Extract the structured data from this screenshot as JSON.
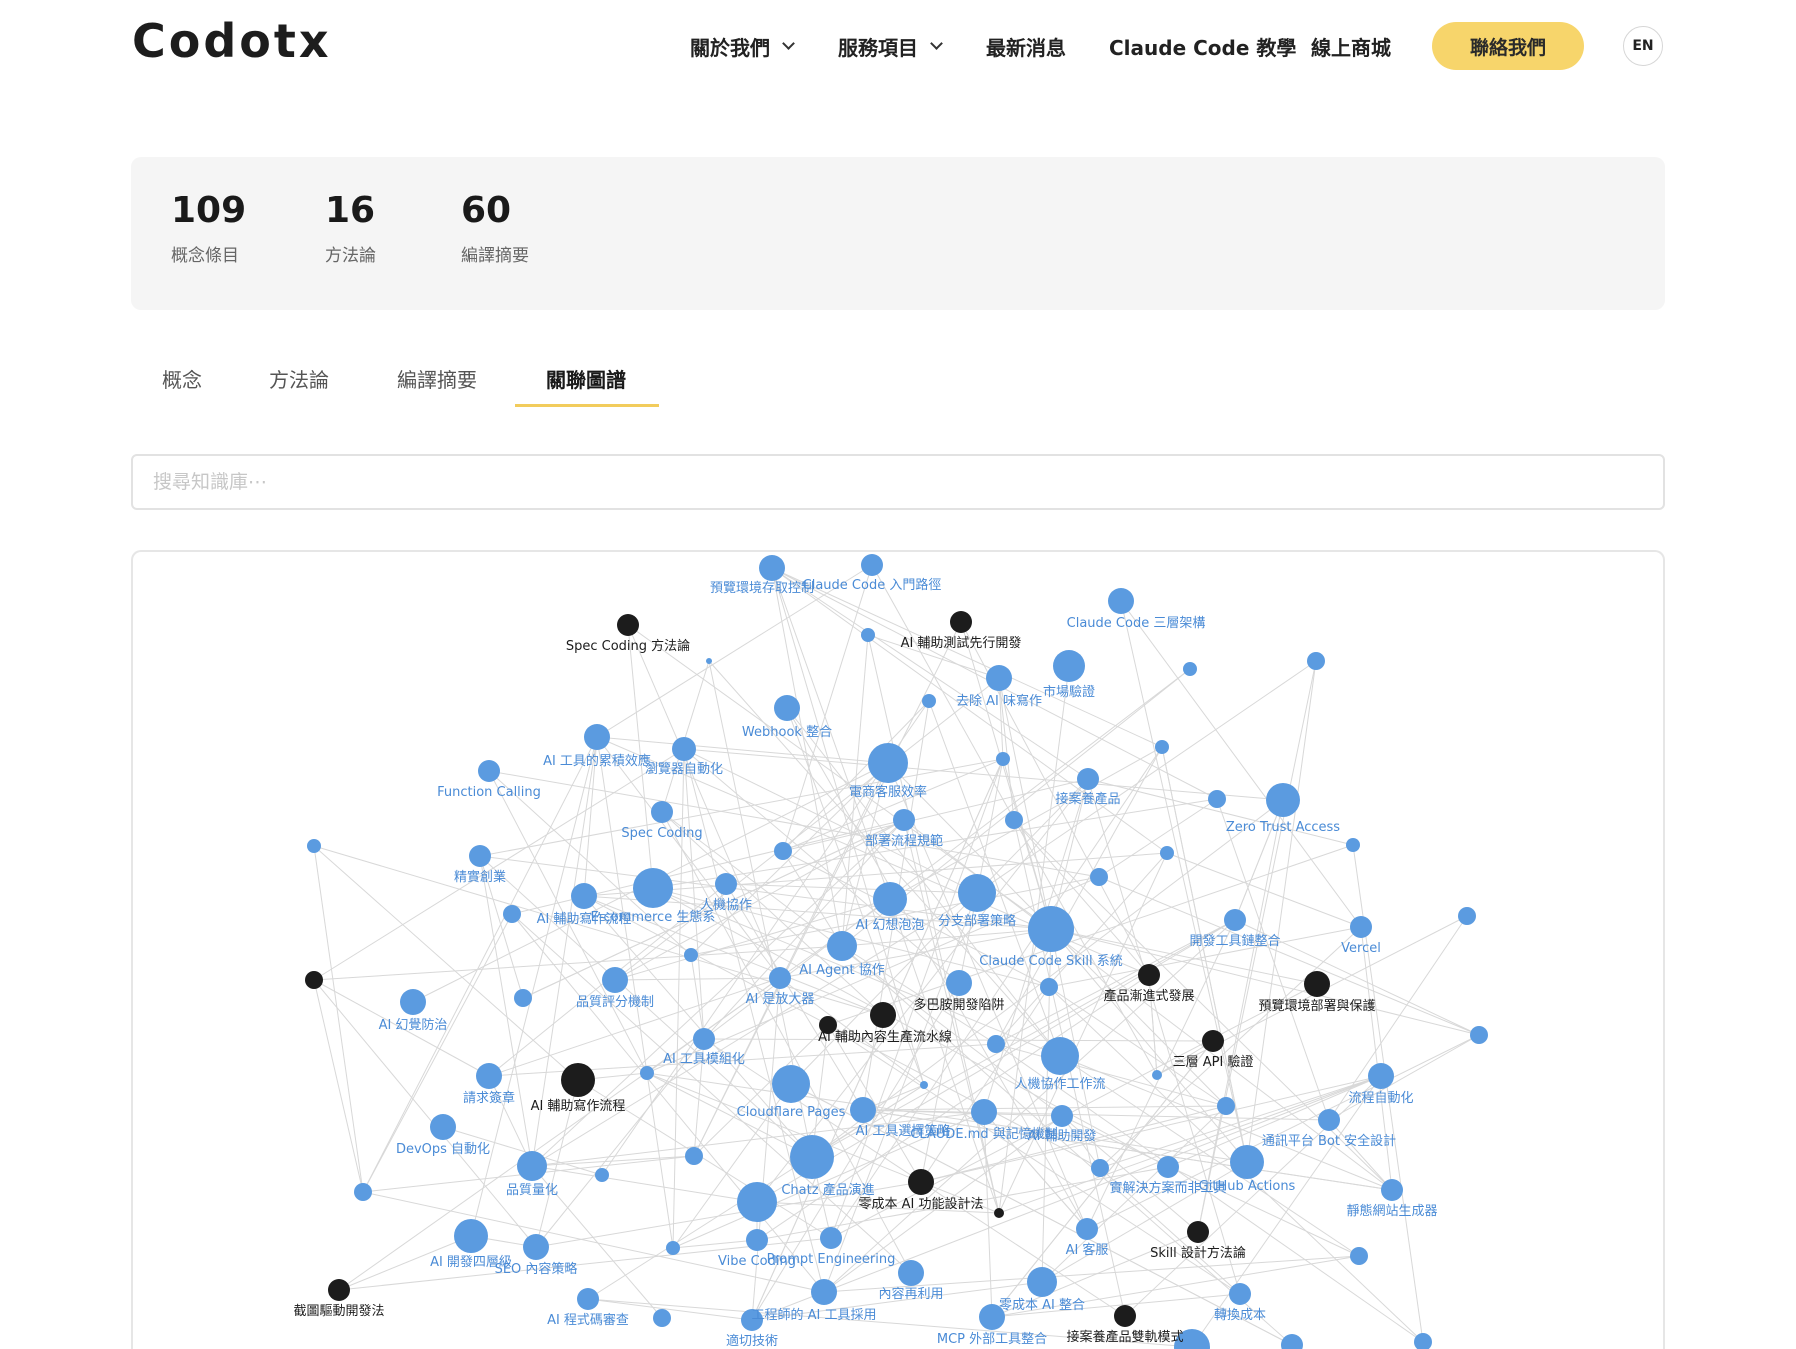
{
  "header": {
    "logo": "Codotx",
    "nav": [
      {
        "label": "關於我們",
        "dropdown": true
      },
      {
        "label": "服務項目",
        "dropdown": true
      },
      {
        "label": "最新消息",
        "dropdown": false
      },
      {
        "label": "Claude Code 教學",
        "dropdown": false
      },
      {
        "label": "線上商城",
        "dropdown": false
      }
    ],
    "cta_label": "聯絡我們",
    "lang_label": "EN"
  },
  "stats": [
    {
      "value": "109",
      "label": "概念條目"
    },
    {
      "value": "16",
      "label": "方法論"
    },
    {
      "value": "60",
      "label": "編譯摘要"
    }
  ],
  "tabs": [
    {
      "label": "概念",
      "active": false
    },
    {
      "label": "方法論",
      "active": false
    },
    {
      "label": "編譯摘要",
      "active": false
    },
    {
      "label": "關聯圖譜",
      "active": true
    }
  ],
  "search": {
    "placeholder": "搜尋知識庫⋯",
    "value": ""
  },
  "graph": {
    "colors": {
      "concept": "#5b9be0",
      "concept_label": "#4a8bd6",
      "method": "#1c1c1c",
      "method_label": "#1c1c1c",
      "edge": "#d8d8d8"
    },
    "labels": {
      "n1": "預覽環境存取控制",
      "n2": "Claude Code 入門路徑",
      "n3": "Spec Coding 方法論",
      "n4": "AI 輔助測試先行開發",
      "n5": "Claude Code 三層架構",
      "n6": "去除 AI 味寫作",
      "n7": "市場驗證",
      "n8": "Webhook 整合",
      "n9": "AI 工具的累積效應",
      "n10": "瀏覽器自動化",
      "n11": "Function Calling",
      "n12": "電商客服效率",
      "n13": "接案養產品",
      "n14": "Zero Trust Access",
      "n15": "Spec Coding",
      "n16": "部署流程規範",
      "n17": "精實創業",
      "n18": "AI 輔助寫作流程",
      "n19": "Vercel",
      "n20": "E-commerce 生態系",
      "n21": "人機協作",
      "n22": "AI 幻想泡泡",
      "n23": "分支部署策略",
      "n24": "開發工具鏈整合",
      "n25": "Claude Code Skill 系統",
      "n26": "AI Agent 協作",
      "n27": "產品漸進式發展",
      "n28": "預覽環境部署與保護",
      "n29": "品質評分機制",
      "n30": "AI 是放大器",
      "n31": "多巴胺開發陷阱",
      "n32": "AI 幻覺防治",
      "n33": "AI 輔助內容生產流水線",
      "n34": "AI 工具模組化",
      "n35": "三層 API 驗證",
      "n36": "人機協作工作流",
      "n37": "請求簽章",
      "n38": "AI 輔助寫作流程",
      "n39": "Cloudflare Pages",
      "n40": "流程自動化",
      "n41": "AI 工具選擇策略",
      "n42": "CLAUDE.md 與記憶機制",
      "n43": "AI 輔助開發",
      "n44": "通訊平台 Bot 安全設計",
      "n45": "DevOps 自動化",
      "n46": "品質量化",
      "n47": "Chatz 產品演進",
      "n48": "零成本 AI 功能設計法",
      "n49": "實解決方案而非工具",
      "n50": "GitHub Actions",
      "n51": "靜態網站生成器",
      "n52": "Vibe Coding",
      "n53": "Prompt Engineering",
      "n54": "AI 客服",
      "n55": "Skill 設計方法論",
      "n56": "AI 開發四層級",
      "n57": "SEO 內容策略",
      "n58": "內容再利用",
      "n59": "截圖驅動開發法",
      "n60": "AI 程式碼審查",
      "n61": "工程師的 AI 工具採用",
      "n62": "零成本 AI 整合",
      "n63": "轉換成本",
      "n64": "適切技術",
      "n65": "MCP 外部工具整合",
      "n66": "接案養產品雙軌模式"
    }
  }
}
